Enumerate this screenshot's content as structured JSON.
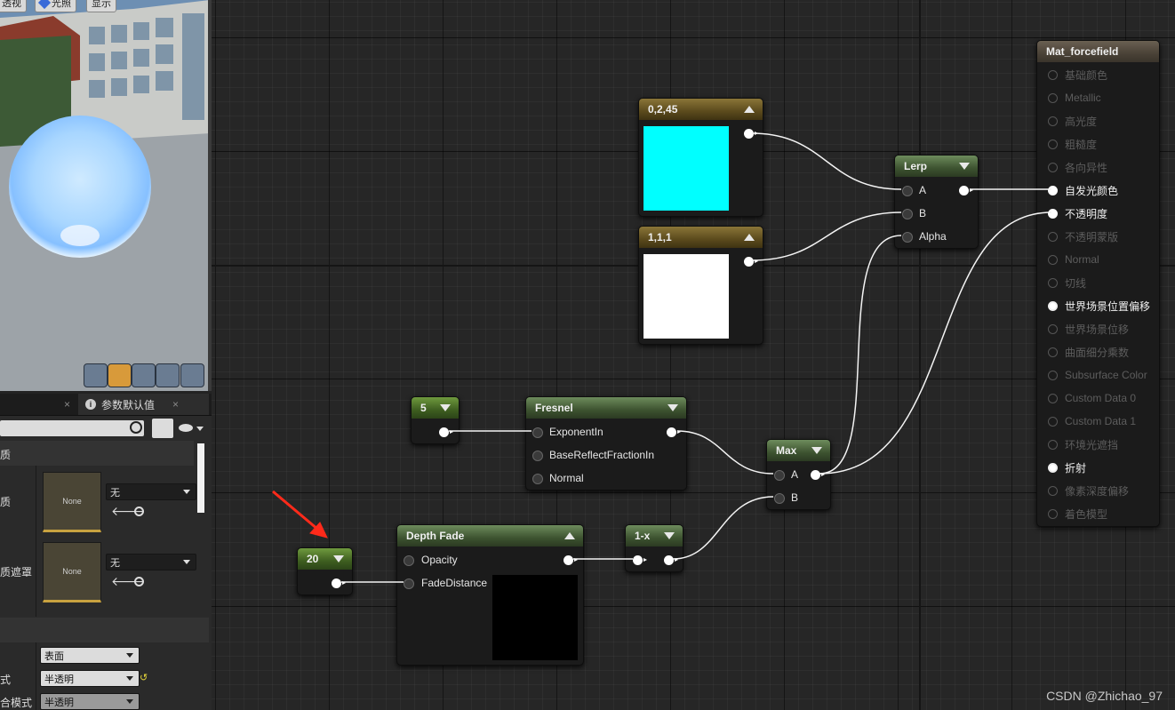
{
  "viewport": {
    "toolbar": {
      "perspective_label": "透视",
      "lit_label": "光照",
      "show_label": "显示"
    }
  },
  "details": {
    "tab_label": "参数默认值",
    "section_material": "质",
    "rows": [
      {
        "label": "质",
        "texture_label": "None",
        "combo_value": "无"
      },
      {
        "label": "质遮罩",
        "texture_label": "None",
        "combo_value": "无"
      }
    ],
    "blend_rows": [
      {
        "label": "",
        "value": "表面"
      },
      {
        "label": "式",
        "value": "半透明"
      },
      {
        "label": "合模式",
        "value": "半透明"
      }
    ]
  },
  "nodes": {
    "color_a": {
      "title": "0,2,45",
      "swatch_color": "#00ffff"
    },
    "color_b": {
      "title": "1,1,1",
      "swatch_color": "#ffffff"
    },
    "lerp": {
      "title": "Lerp",
      "inputs": [
        "A",
        "B",
        "Alpha"
      ]
    },
    "const5": {
      "title": "5"
    },
    "fresnel": {
      "title": "Fresnel",
      "inputs": [
        "ExponentIn",
        "BaseReflectFractionIn",
        "Normal"
      ]
    },
    "max": {
      "title": "Max",
      "inputs": [
        "A",
        "B"
      ]
    },
    "const20": {
      "title": "20"
    },
    "depth_fade": {
      "title": "Depth Fade",
      "inputs": [
        "Opacity",
        "FadeDistance"
      ]
    },
    "one_minus": {
      "title": "1-x"
    },
    "material": {
      "title": "Mat_forcefield",
      "inputs": [
        {
          "label": "基础颜色",
          "state": "dim"
        },
        {
          "label": "Metallic",
          "state": "dim"
        },
        {
          "label": "高光度",
          "state": "dim"
        },
        {
          "label": "粗糙度",
          "state": "dim"
        },
        {
          "label": "各向异性",
          "state": "dim"
        },
        {
          "label": "自发光颜色",
          "state": "connected"
        },
        {
          "label": "不透明度",
          "state": "connected"
        },
        {
          "label": "不透明蒙版",
          "state": "dim"
        },
        {
          "label": "Normal",
          "state": "dim"
        },
        {
          "label": "切线",
          "state": "dim"
        },
        {
          "label": "世界场景位置偏移",
          "state": "active"
        },
        {
          "label": "世界场景位移",
          "state": "dim"
        },
        {
          "label": "曲面细分乘数",
          "state": "dim"
        },
        {
          "label": "Subsurface Color",
          "state": "dim"
        },
        {
          "label": "Custom Data 0",
          "state": "dim"
        },
        {
          "label": "Custom Data 1",
          "state": "dim"
        },
        {
          "label": "环境光遮挡",
          "state": "dim"
        },
        {
          "label": "折射",
          "state": "active"
        },
        {
          "label": "像素深度偏移",
          "state": "dim"
        },
        {
          "label": "着色模型",
          "state": "dim"
        }
      ]
    }
  },
  "watermark": "CSDN @Zhichao_97",
  "colors": {
    "arrow_annotation": "#ff2a1a"
  }
}
